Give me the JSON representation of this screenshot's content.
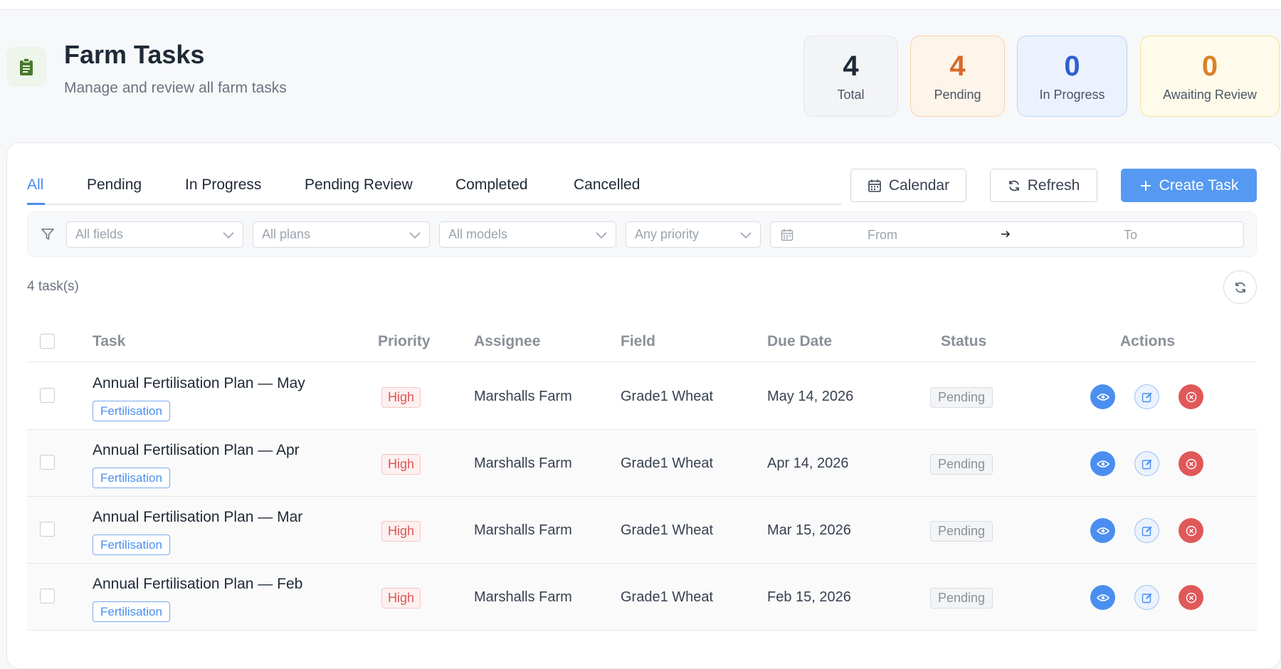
{
  "header": {
    "title": "Farm Tasks",
    "subtitle": "Manage and review all farm tasks",
    "icon": "clipboard-icon"
  },
  "stats": [
    {
      "value": "4",
      "label": "Total",
      "color": "#1f2937"
    },
    {
      "value": "4",
      "label": "Pending",
      "color": "#d9692a"
    },
    {
      "value": "0",
      "label": "In Progress",
      "color": "#2f5fd0"
    },
    {
      "value": "0",
      "label": "Awaiting Review",
      "color": "#d9822a"
    }
  ],
  "tabs": [
    {
      "label": "All",
      "active": true
    },
    {
      "label": "Pending"
    },
    {
      "label": "In Progress"
    },
    {
      "label": "Pending Review"
    },
    {
      "label": "Completed"
    },
    {
      "label": "Cancelled"
    }
  ],
  "toolbar": {
    "calendar_label": "Calendar",
    "refresh_label": "Refresh",
    "create_label": "Create Task"
  },
  "filters": {
    "fields_placeholder": "All fields",
    "plans_placeholder": "All plans",
    "models_placeholder": "All models",
    "priority_placeholder": "Any priority",
    "date_from": "From",
    "date_to": "To"
  },
  "count_text": "4 task(s)",
  "table": {
    "columns": [
      "Task",
      "Priority",
      "Assignee",
      "Field",
      "Due Date",
      "Status",
      "Actions"
    ],
    "rows": [
      {
        "task": "Annual Fertilisation Plan — May",
        "tag": "Fertilisation",
        "priority": "High",
        "assignee": "Marshalls Farm",
        "field": "Grade1 Wheat",
        "due": "May 14, 2026",
        "status": "Pending"
      },
      {
        "task": "Annual Fertilisation Plan — Apr",
        "tag": "Fertilisation",
        "priority": "High",
        "assignee": "Marshalls Farm",
        "field": "Grade1 Wheat",
        "due": "Apr 14, 2026",
        "status": "Pending"
      },
      {
        "task": "Annual Fertilisation Plan — Mar",
        "tag": "Fertilisation",
        "priority": "High",
        "assignee": "Marshalls Farm",
        "field": "Grade1 Wheat",
        "due": "Mar 15, 2026",
        "status": "Pending"
      },
      {
        "task": "Annual Fertilisation Plan — Feb",
        "tag": "Fertilisation",
        "priority": "High",
        "assignee": "Marshalls Farm",
        "field": "Grade1 Wheat",
        "due": "Feb 15, 2026",
        "status": "Pending"
      }
    ]
  },
  "colors": {
    "accent": "#4a8ef0",
    "primary_button": "#5599f2",
    "danger": "#e05858",
    "brand_green": "#4a7a2e"
  }
}
